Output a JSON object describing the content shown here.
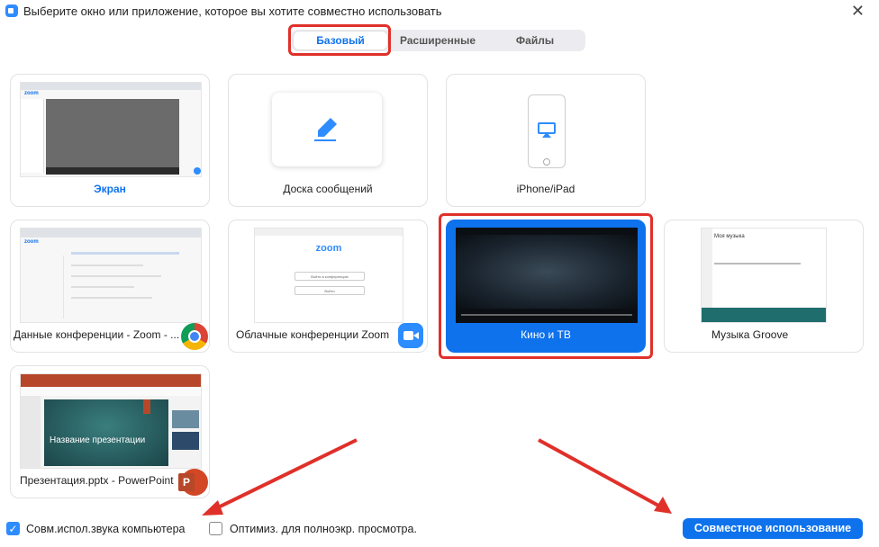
{
  "window": {
    "title": "Выберите окно или приложение, которое вы хотите совместно использовать"
  },
  "tabs": [
    {
      "label": "Базовый",
      "active": true
    },
    {
      "label": "Расширенные",
      "active": false
    },
    {
      "label": "Файлы",
      "active": false
    }
  ],
  "tiles": [
    {
      "label": "Экран"
    },
    {
      "label": "Доска сообщений"
    },
    {
      "label": "iPhone/iPad"
    },
    {
      "label": "Данные конференции - Zoom - ..."
    },
    {
      "label": "Облачные конференции Zoom"
    },
    {
      "label": "Кино и ТВ",
      "selected": true
    },
    {
      "label": "Музыка Groove"
    },
    {
      "label": "Презентация.pptx - PowerPoint"
    }
  ],
  "thumbs": {
    "zoom_logo": "zoom",
    "join_button": "Войти в конференцию",
    "signin_button": "Войти",
    "ppt_slide_title": "Название презентации",
    "groove_title": "Моя музыка"
  },
  "bottom": {
    "audio_checkbox": {
      "label": "Совм.испол.звука компьютера",
      "checked": true
    },
    "optimize_checkbox": {
      "label": "Оптимиз. для полноэкр. просмотра.",
      "checked": false
    },
    "share_button": "Совместное использование"
  },
  "colors": {
    "accent": "#0e72ed",
    "highlight": "#e0302a"
  }
}
